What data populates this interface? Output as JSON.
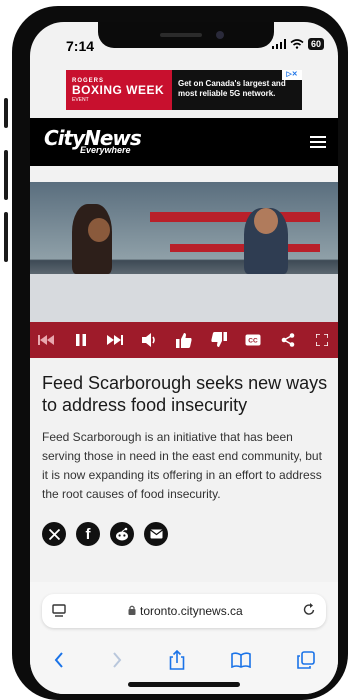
{
  "status": {
    "time": "7:14",
    "battery": "60"
  },
  "ad": {
    "brand": "ROGERS",
    "title": "BOXING WEEK",
    "subtitle": "EVENT",
    "text": "Get on Canada's largest and most reliable 5G network."
  },
  "site": {
    "logo": "CityNews",
    "logo_sub": "Everywhere"
  },
  "article": {
    "headline": "Feed Scarborough seeks new ways to address food insecurity",
    "summary": "Feed Scarborough is an initiative that has been serving those in need in the east end community, but it is now expanding its offering in an effort to address the root causes of food insecurity."
  },
  "browser": {
    "url": "toronto.citynews.ca"
  },
  "colors": {
    "brand_red": "#9e1b2a",
    "ad_red": "#c8102e",
    "header_bg": "#000000",
    "ios_blue": "#1a73e8"
  },
  "icons": {
    "video_controls": [
      "skip-back-icon",
      "pause-icon",
      "skip-forward-icon",
      "volume-icon",
      "thumbs-up-icon",
      "thumbs-down-icon",
      "captions-icon",
      "share-icon",
      "fullscreen-icon"
    ],
    "share": [
      "x-twitter-icon",
      "facebook-icon",
      "reddit-icon",
      "email-icon"
    ],
    "toolbar": [
      "back-icon",
      "forward-icon",
      "share-icon",
      "bookmarks-icon",
      "tabs-icon"
    ]
  }
}
